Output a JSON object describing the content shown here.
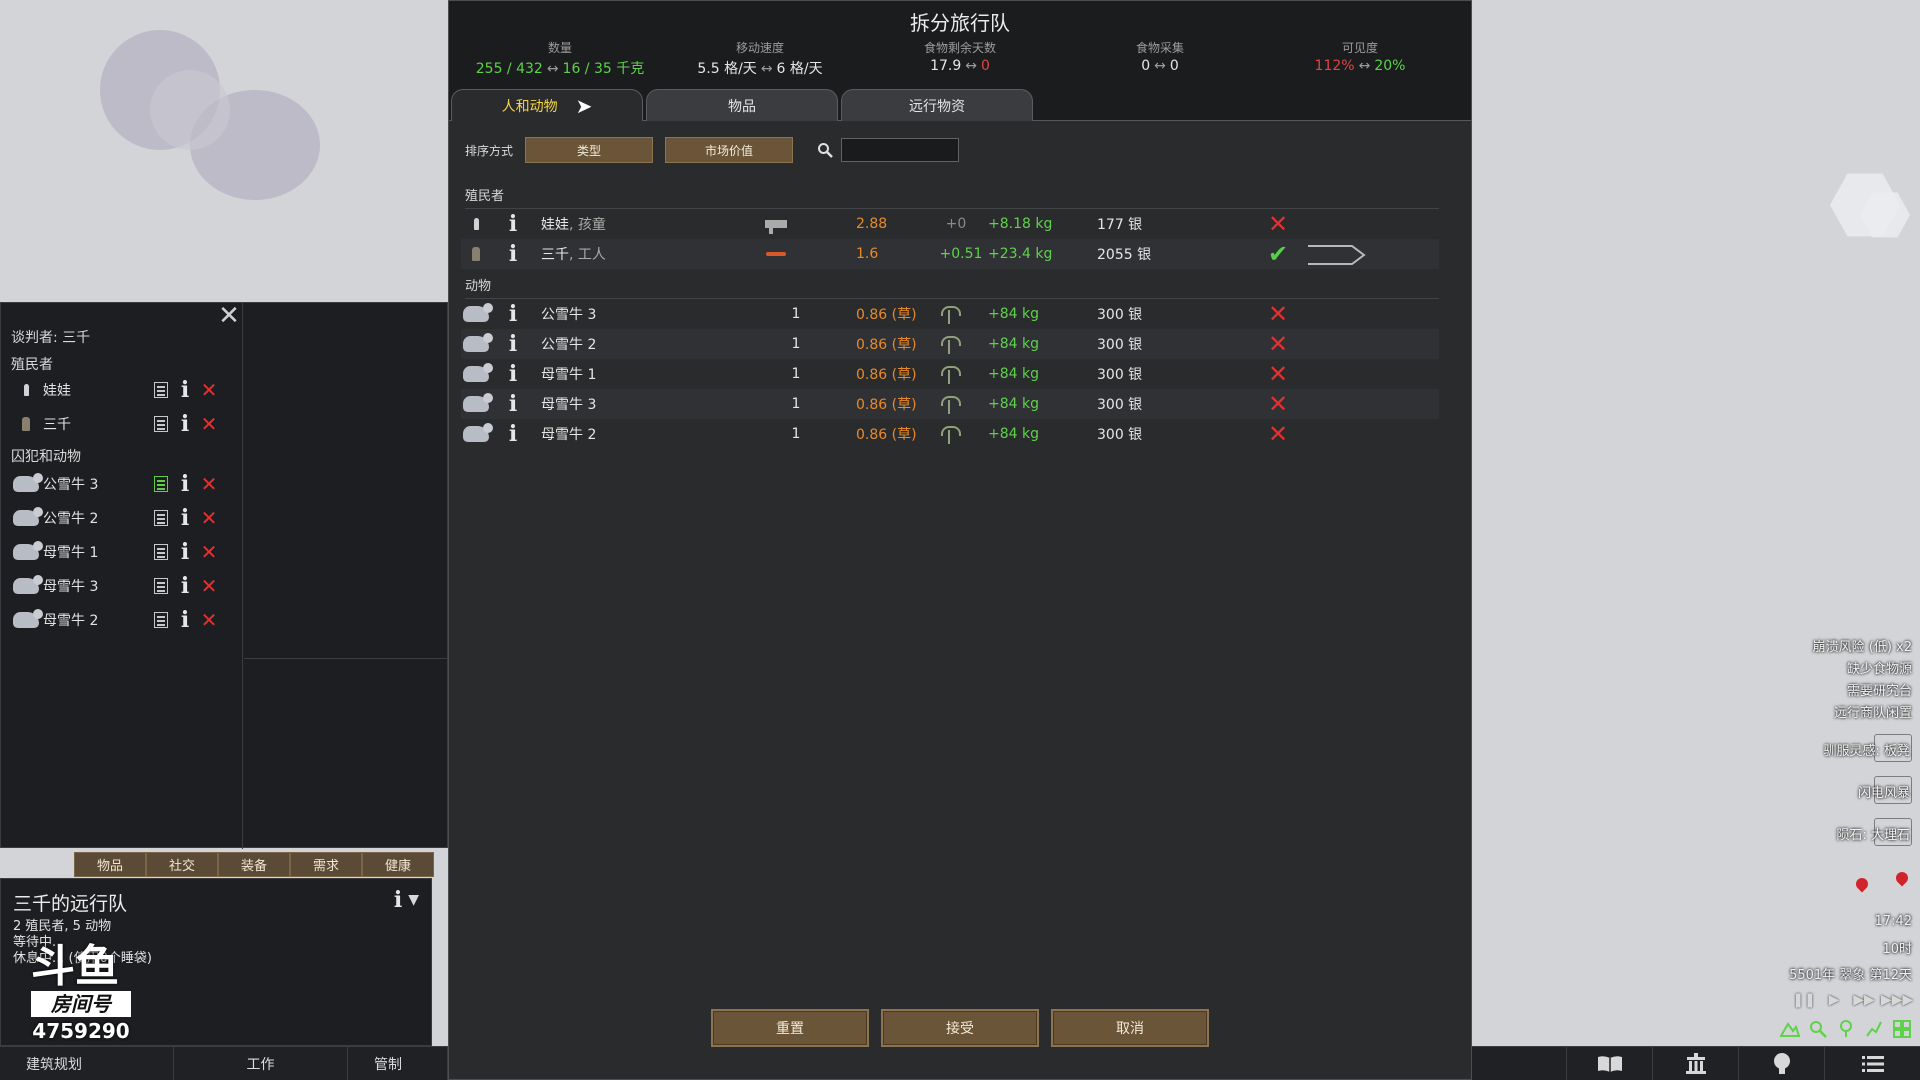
{
  "dialog": {
    "title": "拆分旅行队",
    "stats": [
      {
        "label": "数量",
        "left": "255 / 432",
        "right": "16 / 35 千克",
        "left_color": "#5ed24a",
        "right_color": "#5ed24a"
      },
      {
        "label": "移动速度",
        "left": "5.5 格/天",
        "right": "6 格/天",
        "left_color": "#e6e6e6",
        "right_color": "#e6e6e6"
      },
      {
        "label": "食物剩余天数",
        "left": "17.9",
        "right": "0",
        "left_color": "#e6e6e6",
        "right_color": "#e04545"
      },
      {
        "label": "食物采集",
        "left": "0",
        "right": "0",
        "left_color": "#e6e6e6",
        "right_color": "#e6e6e6"
      },
      {
        "label": "可见度",
        "left": "112%",
        "right": "20%",
        "left_color": "#e04545",
        "right_color": "#5ed24a"
      }
    ],
    "tabs": [
      "人和动物",
      "物品",
      "远行物资"
    ],
    "active_tab": "人和动物",
    "sort_label": "排序方式",
    "sort_buttons": [
      "类型",
      "市场价值"
    ],
    "search_placeholder": "",
    "colonists_header": "殖民者",
    "colonists": [
      {
        "name": "娃娃",
        "sub": ", 孩童",
        "speed": "2.88",
        "delta": "+0",
        "delta_color": "#8a8a8a",
        "mass": "+8.18 kg",
        "value": "177 银",
        "gear": "gun",
        "selected": false
      },
      {
        "name": "三千",
        "sub": ", 工人",
        "speed": "1.6",
        "delta": "+0.51",
        "delta_color": "#5ed24a",
        "mass": "+23.4 kg",
        "value": "2055 银",
        "gear": "tool",
        "selected": true
      }
    ],
    "animals_header": "动物",
    "animals": [
      {
        "name": "公雪牛 3",
        "count": "1",
        "speed": "0.86 (草)",
        "mass": "+84 kg",
        "value": "300 银"
      },
      {
        "name": "公雪牛 2",
        "count": "1",
        "speed": "0.86 (草)",
        "mass": "+84 kg",
        "value": "300 银"
      },
      {
        "name": "母雪牛 1",
        "count": "1",
        "speed": "0.86 (草)",
        "mass": "+84 kg",
        "value": "300 银"
      },
      {
        "name": "母雪牛 3",
        "count": "1",
        "speed": "0.86 (草)",
        "mass": "+84 kg",
        "value": "300 银"
      },
      {
        "name": "母雪牛 2",
        "count": "1",
        "speed": "0.86 (草)",
        "mass": "+84 kg",
        "value": "300 银"
      }
    ],
    "buttons": {
      "reset": "重置",
      "accept": "接受",
      "cancel": "取消"
    }
  },
  "left_panel": {
    "negotiator": "谈判者: 三千",
    "colonists_header": "殖民者",
    "colonists": [
      "娃娃",
      "三千"
    ],
    "prisoners_header": "囚犯和动物",
    "animals": [
      "公雪牛 3",
      "公雪牛 2",
      "母雪牛 1",
      "母雪牛 3",
      "母雪牛 2"
    ]
  },
  "inspect_tabs": [
    "物品",
    "社交",
    "装备",
    "需求",
    "健康"
  ],
  "caravan": {
    "title": "三千的远行队",
    "line1": "2 殖民者, 5 动物",
    "line2": "等待中.",
    "line3": "休息中... (使用0个睡袋)"
  },
  "watermark": {
    "logo": "斗鱼",
    "tag": "房间号",
    "room": "4759290"
  },
  "bottom_bar": {
    "architect": "建筑规划",
    "work": "工作",
    "restrict": "管制"
  },
  "alerts": [
    "崩溃风险 (低) x2",
    "缺少食物源",
    "需要研究台",
    "远行商队闲置"
  ],
  "events": [
    "驯服灵感: 板凳",
    "闪电风暴",
    "陨石: 大理石"
  ],
  "clock": {
    "time": "17:42",
    "hour": "10时",
    "date": "5501年 翠象 第12天"
  },
  "colors": {
    "accent_tab": "#f5d442",
    "button_brown": "#6a5538",
    "positive": "#5ed24a",
    "negative": "#e04545",
    "speed_orange": "#e88a2a"
  }
}
